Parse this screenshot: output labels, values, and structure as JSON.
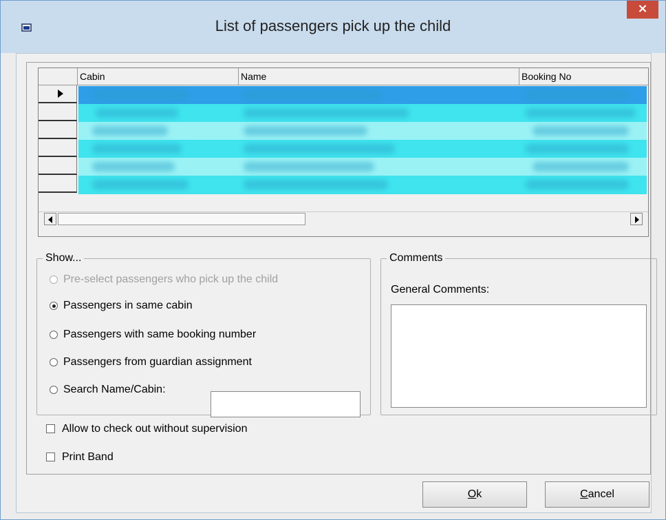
{
  "window": {
    "title": "List of passengers pick up the child",
    "close_label": "×"
  },
  "grid": {
    "columns": [
      "Cabin",
      "Name",
      "Booking No"
    ],
    "row_count": 6
  },
  "show_group": {
    "legend": "Show...",
    "options": [
      {
        "label": "Pre-select passengers who pick up the child",
        "checked": false,
        "enabled": false
      },
      {
        "label": "Passengers in same cabin",
        "checked": true,
        "enabled": true
      },
      {
        "label": "Passengers with same booking number",
        "checked": false,
        "enabled": true
      },
      {
        "label": "Passengers from guardian assignment",
        "checked": false,
        "enabled": true
      },
      {
        "label": "Search Name/Cabin:",
        "checked": false,
        "enabled": true
      }
    ],
    "search_value": ""
  },
  "comments_group": {
    "legend": "Comments",
    "general_label": "General Comments:",
    "general_value": ""
  },
  "checkboxes": {
    "allow_checkout": {
      "label": "Allow to check out without supervision",
      "checked": false
    },
    "print_band": {
      "label": "Print Band",
      "checked": false
    }
  },
  "buttons": {
    "ok_mnemonic": "O",
    "ok_rest": "k",
    "cancel_mnemonic": "C",
    "cancel_rest": "ancel"
  },
  "colors": {
    "grid_highlight": "#3ee3ec",
    "close_button": "#c74a3a",
    "titlebar": "#c9dcee"
  }
}
